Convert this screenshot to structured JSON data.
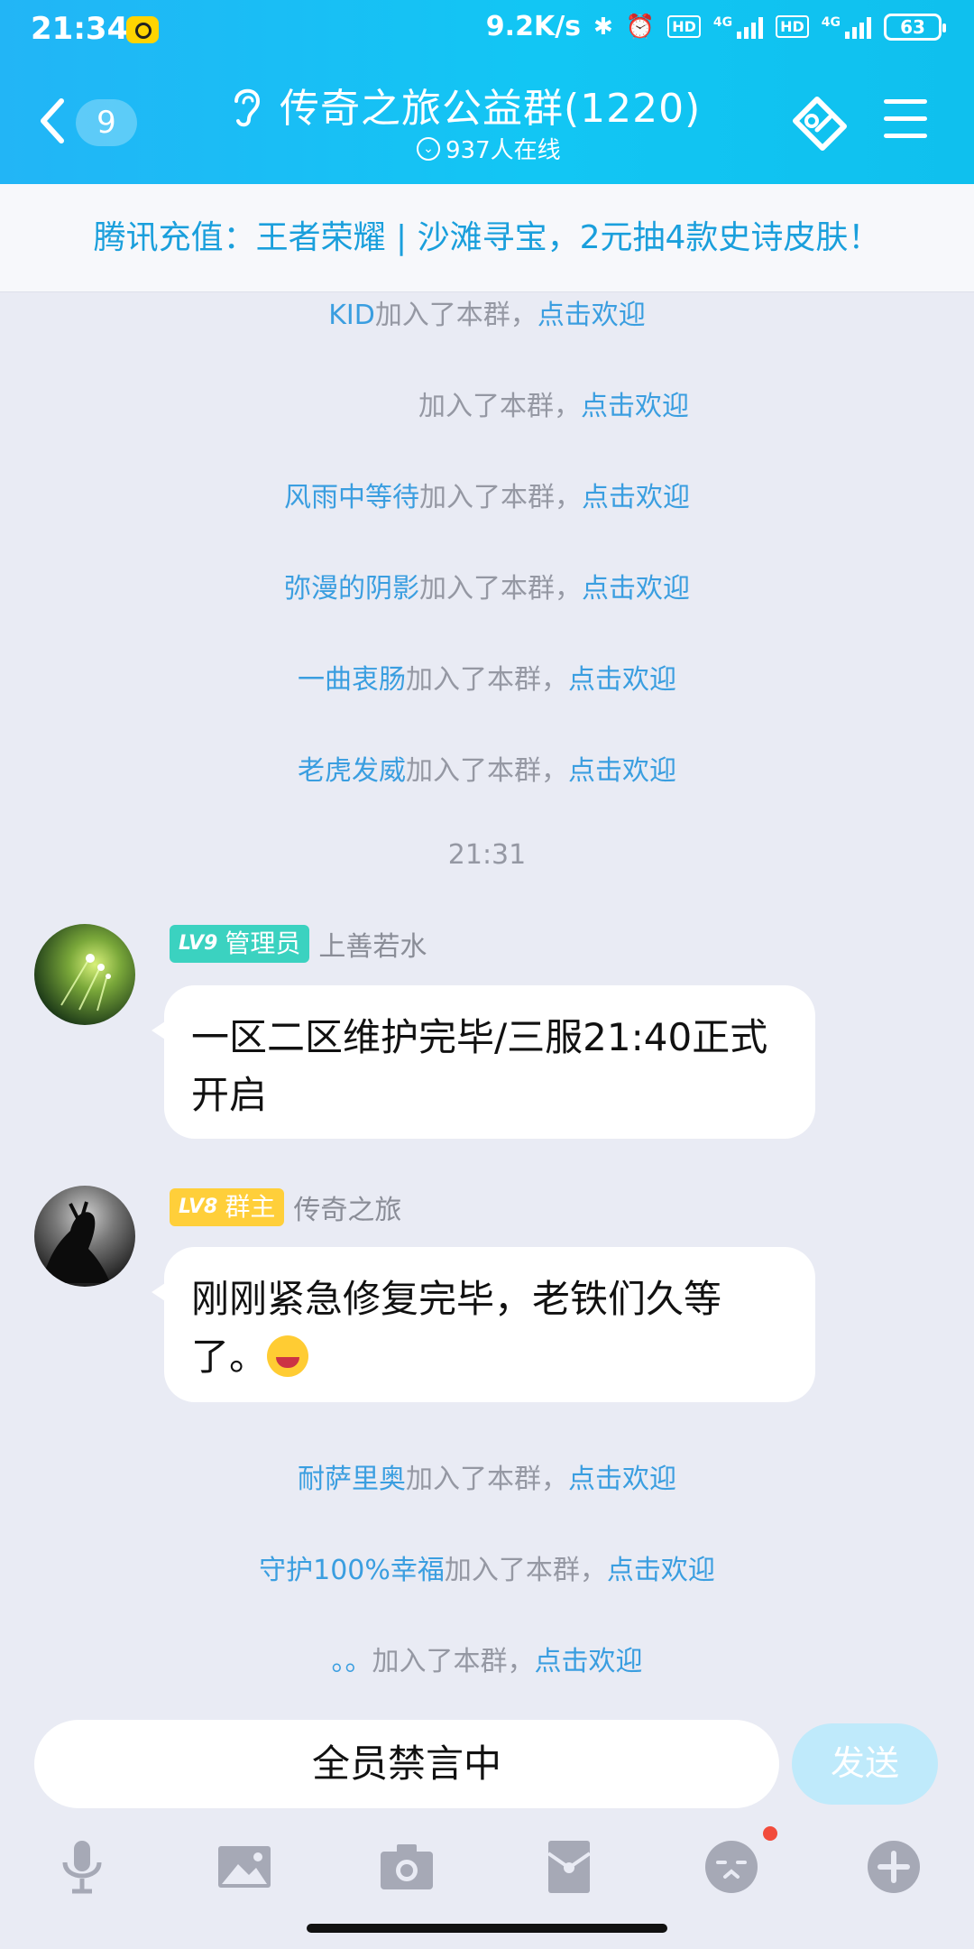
{
  "status": {
    "time": "21:34",
    "net_speed": "9.2K/s",
    "signal1_label": "4G",
    "signal2_label": "4G",
    "hd1": "HD",
    "hd2": "HD",
    "battery": "63"
  },
  "header": {
    "unread_count": "9",
    "title": "传奇之旅公益群(1220)",
    "online_text": "937人在线"
  },
  "banner": {
    "text": "腾讯充值：王者荣耀 | 沙滩寻宝，2元抽4款史诗皮肤！"
  },
  "join_suffix": "加入了本群，",
  "welcome_link": "点击欢迎",
  "joins_top": [
    {
      "name": "KID"
    },
    {
      "name": ""
    },
    {
      "name": "风雨中等待"
    },
    {
      "name": "弥漫的阴影"
    },
    {
      "name": "一曲衷肠"
    },
    {
      "name": "老虎发威"
    }
  ],
  "timestamp": "21:31",
  "messages": [
    {
      "badge_level": "LV9",
      "badge_role": "管理员",
      "sender": "上善若水",
      "text": "一区二区维护完毕/三服21:40正式开启"
    },
    {
      "badge_level": "LV8",
      "badge_role": "群主",
      "sender": "传奇之旅",
      "text": "刚刚紧急修复完毕，老铁们久等了。"
    }
  ],
  "joins_bottom": [
    {
      "name": "耐萨里奥"
    },
    {
      "name": "守护100%幸福"
    },
    {
      "name": "。。"
    }
  ],
  "input": {
    "placeholder": "全员禁言中",
    "send_label": "发送"
  },
  "toolbar": {
    "icons": [
      "microphone-icon",
      "image-icon",
      "camera-icon",
      "red-packet-icon",
      "emoji-icon",
      "plus-icon"
    ]
  }
}
